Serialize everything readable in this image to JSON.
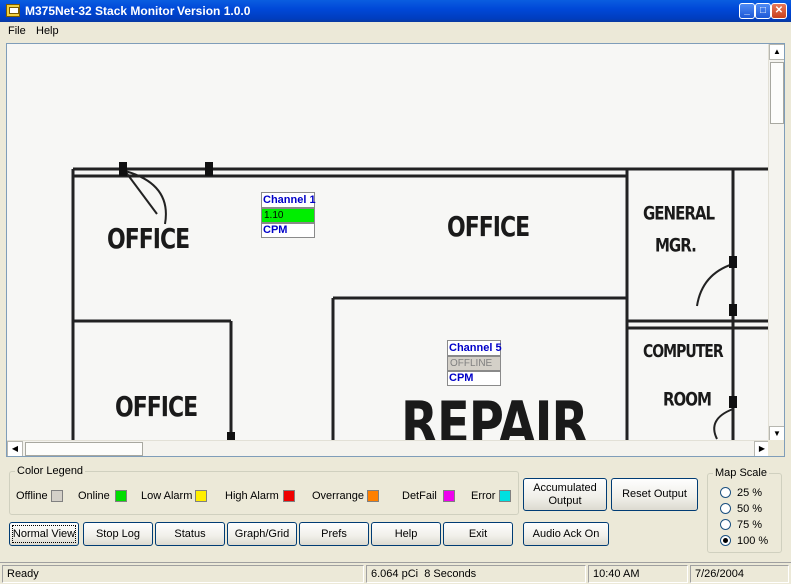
{
  "window": {
    "title": "M375Net-32 Stack Monitor",
    "version": "Version 1.0.0",
    "minimize_glyph": "_",
    "maximize_glyph": "□",
    "close_glyph": "✕"
  },
  "menu": {
    "file": "File",
    "help": "Help"
  },
  "map": {
    "rooms": [
      "OFFICE",
      "OFFICE",
      "GENERAL",
      "MGR.",
      "OFFICE",
      "COMPUTER",
      "ROOM",
      "REPAIR"
    ],
    "channels": [
      {
        "name": "Channel 1",
        "value": "1.10",
        "unit": "CPM",
        "value_color": "#00ee00",
        "value_text_color": "#000000"
      },
      {
        "name": "Channel 5",
        "value": "OFFLINE",
        "unit": "CPM",
        "value_color": "#d4d0c8",
        "value_text_color": "#808080"
      }
    ]
  },
  "legend": {
    "title": "Color Legend",
    "items": [
      {
        "label": "Offline",
        "color": "#d4d0c8"
      },
      {
        "label": "Online",
        "color": "#00dd00"
      },
      {
        "label": "Low Alarm",
        "color": "#ffee00"
      },
      {
        "label": "High Alarm",
        "color": "#ee0000"
      },
      {
        "label": "Overrange",
        "color": "#ff8000"
      },
      {
        "label": "DetFail",
        "color": "#ee00ee"
      },
      {
        "label": "Error",
        "color": "#00e0e0"
      }
    ]
  },
  "buttons": {
    "accumulated_output": "Accumulated Output",
    "reset_output": "Reset Output",
    "normal_view": "Normal View",
    "stop_log": "Stop Log",
    "status": "Status",
    "graph_grid": "Graph/Grid",
    "prefs": "Prefs",
    "help": "Help",
    "exit": "Exit",
    "audio_ack": "Audio Ack On"
  },
  "map_scale": {
    "title": "Map Scale",
    "options": [
      "25 %",
      "50 %",
      "75 %",
      "100 %"
    ],
    "selected": "100 %"
  },
  "status": {
    "state": "Ready",
    "reading": "6.064 pCi  8 Seconds",
    "time": "10:40 AM",
    "date": "7/26/2004"
  }
}
